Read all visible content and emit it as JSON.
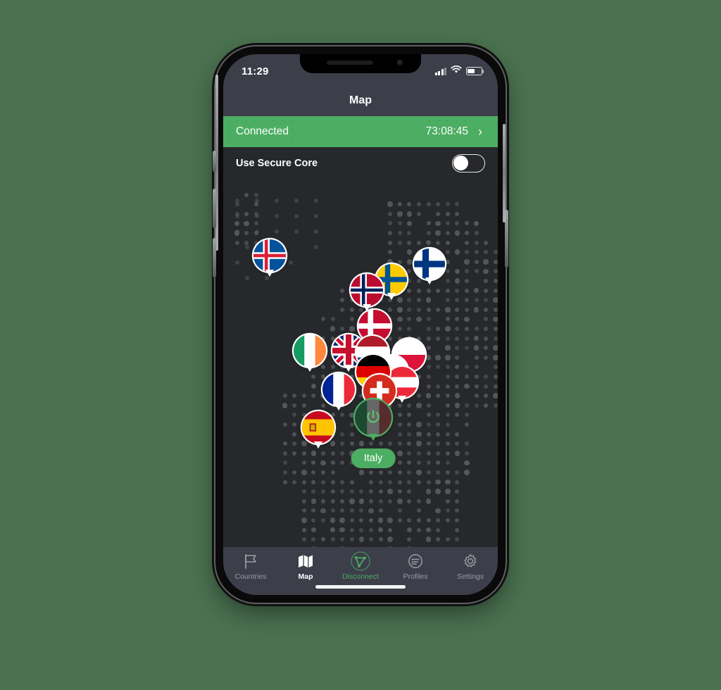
{
  "background_color": "#4a7150",
  "status_bar": {
    "time": "11:29",
    "signal_icon": "cellular-signal-icon",
    "wifi_icon": "wifi-icon",
    "battery_icon": "battery-icon",
    "battery_level_pct": 52
  },
  "nav": {
    "title": "Map"
  },
  "banner": {
    "status_label": "Connected",
    "timer": "73:08:45",
    "chevron": "›",
    "color": "#4cae62"
  },
  "secure_core": {
    "label": "Use Secure Core",
    "enabled": false
  },
  "map": {
    "background_color": "#26282b",
    "dot_color": "#55595c",
    "connected_country": "Italy",
    "connected_pin_icon": "power-icon",
    "pins": [
      {
        "country": "Iceland",
        "flag": "flag-iceland"
      },
      {
        "country": "Norway",
        "flag": "flag-norway"
      },
      {
        "country": "Sweden",
        "flag": "flag-sweden"
      },
      {
        "country": "Finland",
        "flag": "flag-finland"
      },
      {
        "country": "Denmark",
        "flag": "flag-denmark"
      },
      {
        "country": "Ireland",
        "flag": "flag-ireland"
      },
      {
        "country": "United Kingdom",
        "flag": "flag-uk"
      },
      {
        "country": "Netherlands",
        "flag": "flag-netherlands"
      },
      {
        "country": "Germany",
        "flag": "flag-germany"
      },
      {
        "country": "Poland",
        "flag": "flag-poland"
      },
      {
        "country": "Czech Republic",
        "flag": "flag-czechia"
      },
      {
        "country": "Austria",
        "flag": "flag-austria"
      },
      {
        "country": "Switzerland",
        "flag": "flag-switzerland"
      },
      {
        "country": "France",
        "flag": "flag-france"
      },
      {
        "country": "Spain",
        "flag": "flag-spain"
      },
      {
        "country": "Italy",
        "flag": "flag-italy"
      }
    ]
  },
  "tab_bar": {
    "items": [
      {
        "label": "Countries",
        "icon": "flag-icon",
        "state": "inactive"
      },
      {
        "label": "Map",
        "icon": "map-icon",
        "state": "active"
      },
      {
        "label": "Disconnect",
        "icon": "protonvpn-icon",
        "state": "accent"
      },
      {
        "label": "Profiles",
        "icon": "profiles-icon",
        "state": "inactive"
      },
      {
        "label": "Settings",
        "icon": "gear-icon",
        "state": "inactive"
      }
    ]
  }
}
